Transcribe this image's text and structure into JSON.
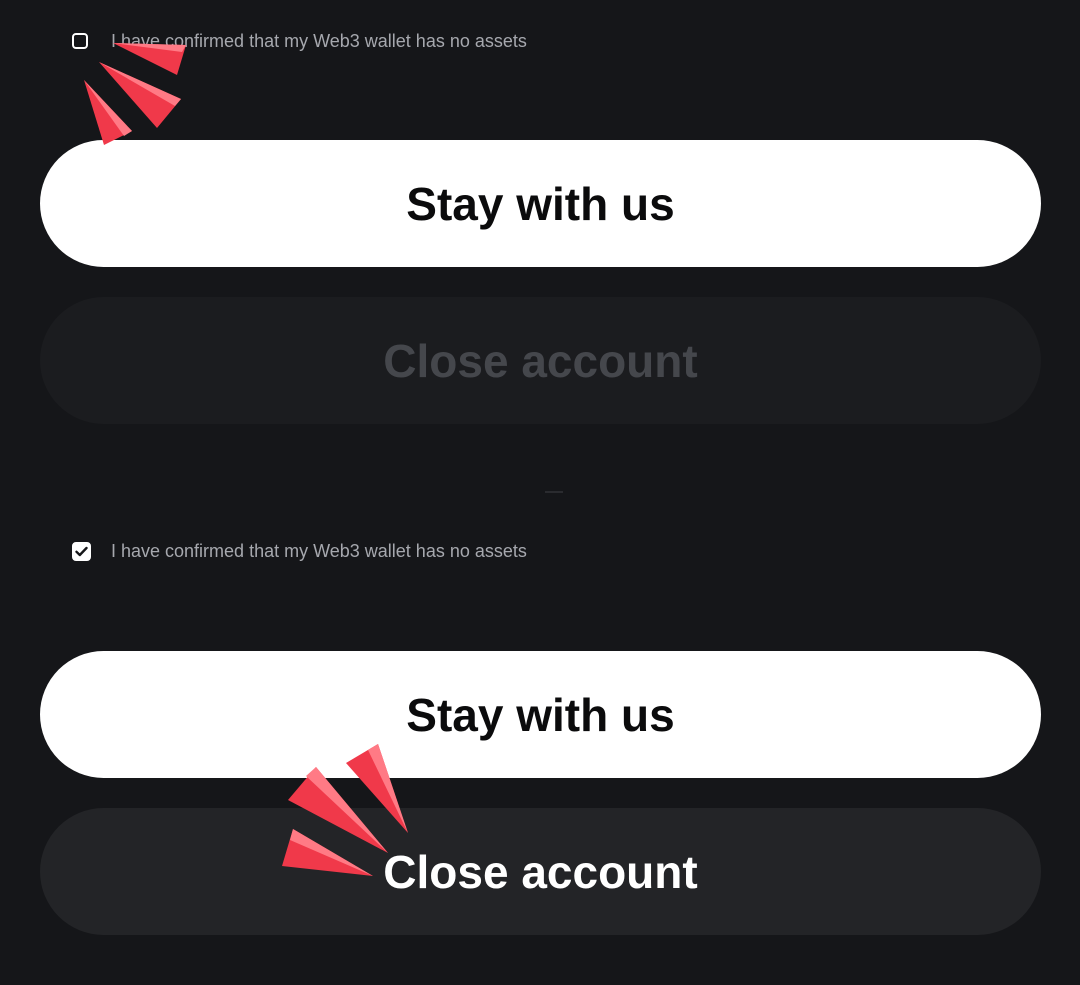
{
  "before": {
    "checkbox": {
      "checked": false,
      "label": "I have confirmed that my Web3 wallet has no assets"
    },
    "stay_button": {
      "label": "Stay with us"
    },
    "close_button": {
      "label": "Close account",
      "state": "disabled"
    }
  },
  "after": {
    "checkbox": {
      "checked": true,
      "label": "I have confirmed that my Web3 wallet has no assets"
    },
    "stay_button": {
      "label": "Stay with us"
    },
    "close_button": {
      "label": "Close account",
      "state": "enabled"
    }
  },
  "icons": {
    "checkmark": "check-icon",
    "highlight": "sparkle-burst-icon"
  },
  "colors": {
    "background": "#151619",
    "primary_button": "#ffffff",
    "secondary_button": "#232427",
    "disabled_button": "#1b1c1f",
    "disabled_text": "#45474c",
    "label_text": "#a6a8ae",
    "highlight": "#f0394a"
  }
}
